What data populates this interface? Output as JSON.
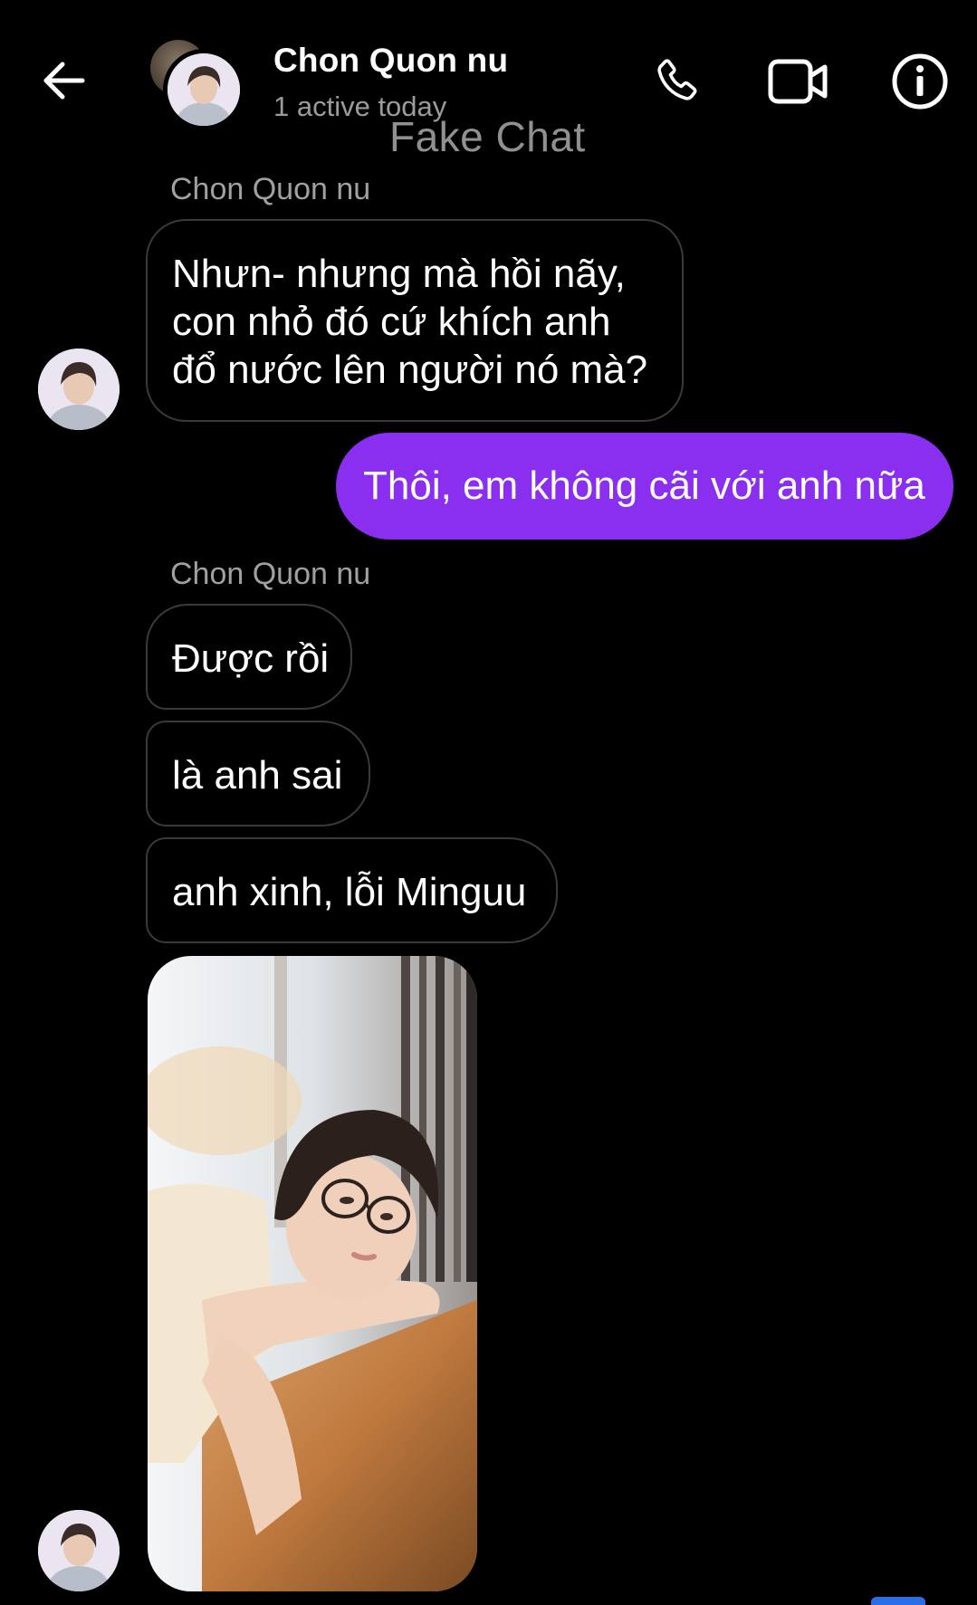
{
  "header": {
    "contact_name": "Chon Quon nu",
    "status": "1 active today",
    "watermark": "Fake Chat",
    "icons": {
      "back": "back-arrow-icon",
      "phone": "phone-icon",
      "video": "video-camera-icon",
      "info": "info-icon"
    }
  },
  "messages": {
    "group1_sender": "Chon Quon nu",
    "m1_line1": "Nhưn- nhưng mà hồi nãy,",
    "m1_line2": "con nhỏ đó cứ khích anh",
    "m1_line3": "đổ nước lên người nó mà?",
    "m2": "Thôi, em không cãi với anh nữa",
    "group2_sender": "Chon Quon nu",
    "m3": "Được rồi",
    "m4": "là anh sai",
    "m5": "anh xinh, lỗi Minguu"
  },
  "colors": {
    "background": "#000000",
    "outgoing_bubble": "#8a2ef0",
    "incoming_border": "#3a3a3a",
    "secondary_text": "#a0a0a0",
    "accent_blue": "#2b6fe8"
  }
}
